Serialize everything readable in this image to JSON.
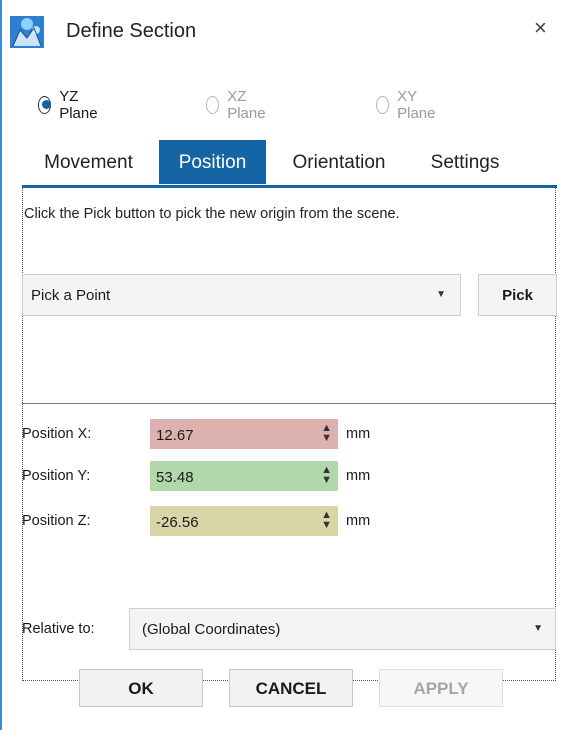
{
  "window": {
    "title": "Define Section",
    "close_glyph": "×",
    "icon": "app-logo-icon"
  },
  "planes": [
    {
      "label": "YZ Plane",
      "selected": true,
      "enabled": true
    },
    {
      "label": "XZ Plane",
      "selected": false,
      "enabled": false
    },
    {
      "label": "XY Plane",
      "selected": false,
      "enabled": false
    }
  ],
  "tabs": [
    {
      "label": "Movement",
      "active": false
    },
    {
      "label": "Position",
      "active": true
    },
    {
      "label": "Orientation",
      "active": false
    },
    {
      "label": "Settings",
      "active": false
    }
  ],
  "position_tab": {
    "hint": "Click the Pick button to pick the new origin from the scene.",
    "pick_select": {
      "value": "Pick a Point",
      "arrow": "▼"
    },
    "pick_button": "Pick",
    "fields": [
      {
        "label": "Position X:",
        "value": "12.67",
        "unit": "mm",
        "color": "#deb1b1"
      },
      {
        "label": "Position Y:",
        "value": "53.48",
        "unit": "mm",
        "color": "#b1d7ab"
      },
      {
        "label": "Position Z:",
        "value": "-26.56",
        "unit": "mm",
        "color": "#d9d5a7"
      }
    ],
    "relative_to": {
      "label": "Relative to:",
      "value": "(Global Coordinates)",
      "arrow": "▼"
    }
  },
  "buttons": {
    "ok": "OK",
    "cancel": "CANCEL",
    "apply": "APPLY"
  },
  "colors": {
    "accent": "#1564a6",
    "window_border": "#3a8fd8"
  }
}
